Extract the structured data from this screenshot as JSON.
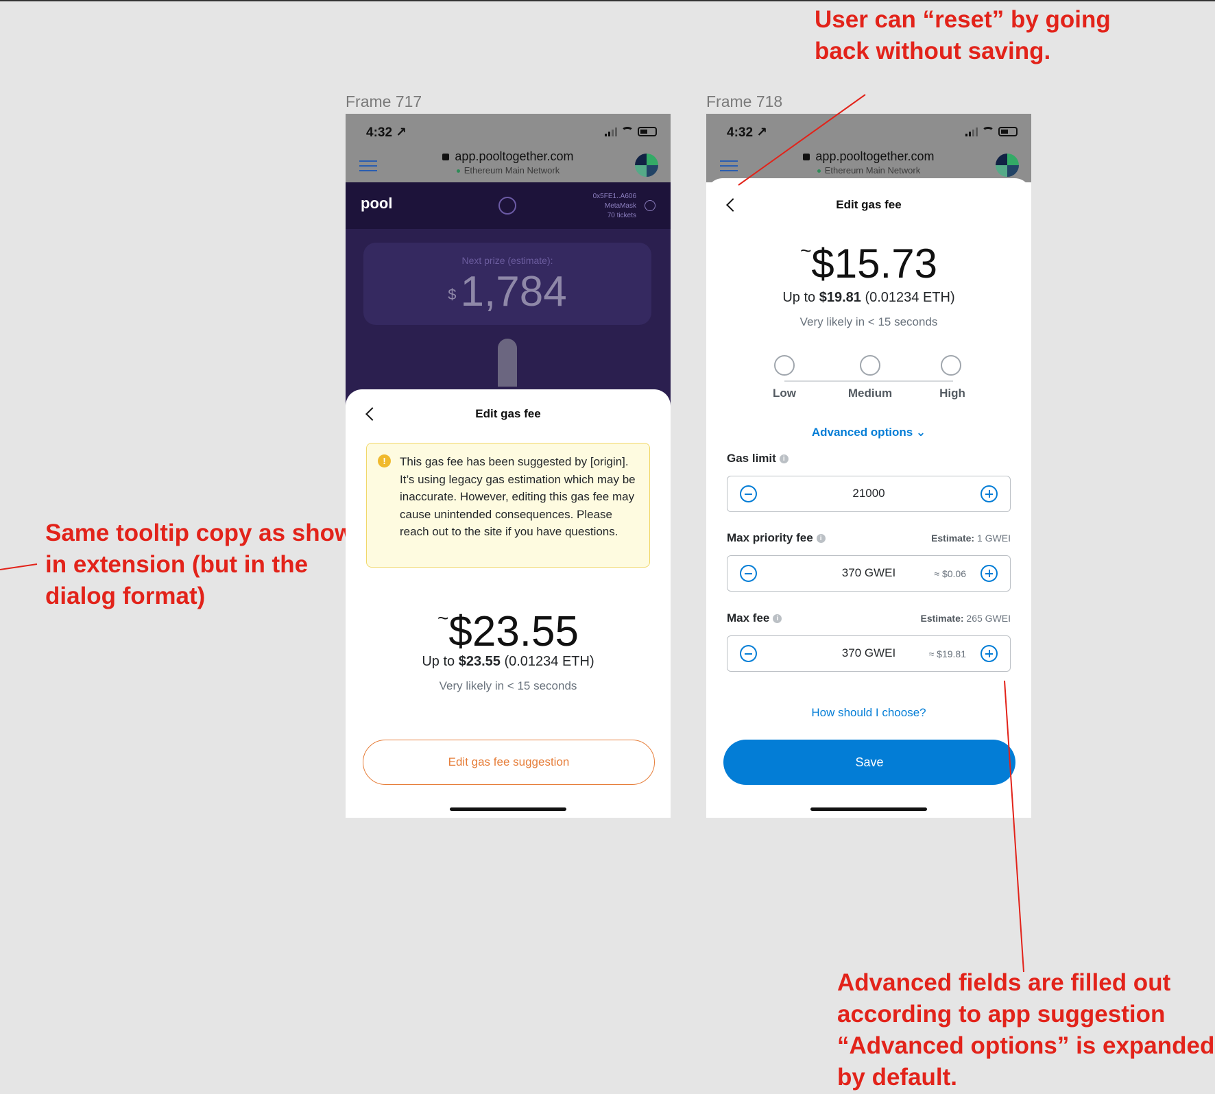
{
  "annotations": {
    "top": "User can “reset” by going back without saving.",
    "top_line1": "User can “reset” by going",
    "top_line2": "back without saving.",
    "left_line1": "Same tooltip copy as shown",
    "left_line2": "in extension (but in the",
    "left_line3": "dialog format)",
    "bottom_line1": "Advanced fields are filled out",
    "bottom_line2": "according to app suggestion",
    "bottom_line3": "“Advanced options” is expanded",
    "bottom_line4": "by default."
  },
  "frames": [
    {
      "label": "Frame 717",
      "status": {
        "time": "4:32 ↗",
        "url": "app.pooltogether.com",
        "network": "Ethereum Main Network"
      },
      "pool": {
        "logo": "pool",
        "account_line1": "0x5FE1..A606",
        "account_line2": "MetaMask",
        "account_line3": "70 tickets",
        "prize_label": "Next prize (estimate):",
        "prize_currency": "$",
        "prize_value": "1,784"
      },
      "sheet": {
        "title": "Edit gas fee",
        "warning_icon": "!",
        "warning": "This gas fee has been suggested by [origin]. It’s using legacy gas estimation which may be inaccurate. However, editing this gas fee may cause unintended consequences. Please reach out to the site if you have questions.",
        "fee_tilde": "~",
        "fee": "$23.55",
        "upto_prefix": "Up to ",
        "upto_amount": "$23.55",
        "upto_suffix": " (0.01234 ETH)",
        "likely": "Very likely in < 15 seconds",
        "edit_button": "Edit gas fee suggestion"
      }
    },
    {
      "label": "Frame 718",
      "status": {
        "time": "4:32 ↗",
        "url": "app.pooltogether.com",
        "network": "Ethereum Main Network"
      },
      "sheet": {
        "title": "Edit gas fee",
        "fee_tilde": "~",
        "fee": "$15.73",
        "upto_prefix": "Up to ",
        "upto_amount": "$19.81",
        "upto_suffix": " (0.01234 ETH)",
        "likely": "Very likely in < 15 seconds",
        "options": [
          "Low",
          "Medium",
          "High"
        ],
        "advanced": "Advanced options ⌄",
        "gas_limit_label": "Gas limit",
        "gas_limit_value": "21000",
        "priority_label": "Max priority fee",
        "priority_est_label": "Estimate:",
        "priority_est_value": " 1 GWEI",
        "priority_value": "370 GWEI",
        "priority_conv": "≈ $0.06",
        "maxfee_label": "Max fee",
        "maxfee_est_label": "Estimate:",
        "maxfee_est_value": " 265 GWEI",
        "maxfee_value": "370 GWEI",
        "maxfee_conv": "≈ $19.81",
        "howto": "How should I choose?",
        "save": "Save"
      }
    }
  ],
  "colors": {
    "annotation": "#e2231a",
    "primary": "#037dd6",
    "warning_bg": "#fefbe0",
    "outline": "#e67e3a"
  }
}
